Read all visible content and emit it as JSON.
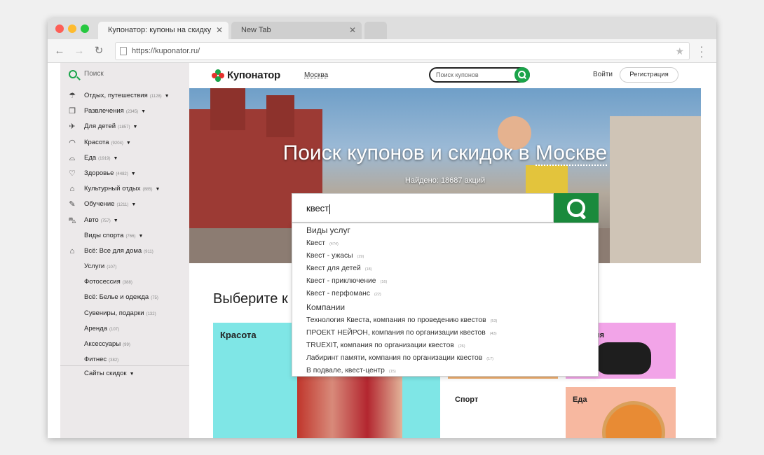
{
  "browser": {
    "tabs": [
      {
        "label": "Купонатор: купоны на скидку"
      },
      {
        "label": "New Tab"
      }
    ],
    "close_glyph": "✕",
    "url": "https://kuponator.ru/",
    "icons": [
      "back-icon",
      "forward-icon",
      "reload-icon",
      "page-icon",
      "star-icon",
      "menu-icon"
    ]
  },
  "sidebar": {
    "search_label": "Поиск",
    "items": [
      {
        "label": "Отдых, путешествия",
        "count": "(1128)",
        "arrow": true,
        "icon": "umbrella-icon",
        "glyph": "☂"
      },
      {
        "label": "Развлечения",
        "count": "(2345)",
        "arrow": true,
        "icon": "cube-icon",
        "glyph": "❒"
      },
      {
        "label": "Для детей",
        "count": "(1857)",
        "arrow": true,
        "icon": "airplane-icon",
        "glyph": "✈"
      },
      {
        "label": "Красота",
        "count": "(9204)",
        "arrow": true,
        "icon": "lips-icon",
        "glyph": "◠"
      },
      {
        "label": "Еда",
        "count": "(1919)",
        "arrow": true,
        "icon": "dish-icon",
        "glyph": "⌓"
      },
      {
        "label": "Здоровье",
        "count": "(4482)",
        "arrow": true,
        "icon": "heart-icon",
        "glyph": "♡"
      },
      {
        "label": "Культурный отдых",
        "count": "(885)",
        "arrow": true,
        "icon": "museum-icon",
        "glyph": "⌂"
      },
      {
        "label": "Обучение",
        "count": "(1211)",
        "arrow": true,
        "icon": "feather-icon",
        "glyph": "✎"
      },
      {
        "label": "Авто",
        "count": "(757)",
        "arrow": true,
        "icon": "car-icon",
        "glyph": "⛍"
      },
      {
        "label": "Виды спорта",
        "count": "(766)",
        "arrow": true,
        "icon": "",
        "glyph": ""
      },
      {
        "label": "Всё: Все для дома",
        "count": "(911)",
        "arrow": false,
        "icon": "house-icon",
        "glyph": "⌂"
      },
      {
        "label": "Услуги",
        "count": "(107)",
        "arrow": false,
        "icon": "",
        "glyph": ""
      },
      {
        "label": "Фотосессия",
        "count": "(388)",
        "arrow": false,
        "icon": "",
        "glyph": ""
      },
      {
        "label": "Всё: Белье и одежда",
        "count": "(75)",
        "arrow": false,
        "icon": "",
        "glyph": ""
      },
      {
        "label": "Сувениры, подарки",
        "count": "(132)",
        "arrow": false,
        "icon": "",
        "glyph": ""
      },
      {
        "label": "Аренда",
        "count": "(107)",
        "arrow": false,
        "icon": "",
        "glyph": ""
      },
      {
        "label": "Аксессуары",
        "count": "(99)",
        "arrow": false,
        "icon": "",
        "glyph": ""
      },
      {
        "label": "Фитнес",
        "count": "(382)",
        "arrow": false,
        "icon": "",
        "glyph": ""
      }
    ],
    "footer_label": "Сайты скидок"
  },
  "header": {
    "logo_text": "Купонатор",
    "city": "Москва",
    "search_placeholder": "Поиск купонов",
    "login": "Войти",
    "register": "Регистрация"
  },
  "hero": {
    "title_prefix": "Поиск купонов и скидок в ",
    "title_city": "Москве",
    "found_text": "Найдено: 18687 акций"
  },
  "search": {
    "value": "квест",
    "groups": [
      {
        "title": "Виды услуг",
        "items": [
          {
            "label": "Квест",
            "count": "(474)"
          },
          {
            "label": "Квест - ужасы",
            "count": "(29)"
          },
          {
            "label": "Квест для детей",
            "count": "(18)"
          },
          {
            "label": "Квест - приключение",
            "count": "(16)"
          },
          {
            "label": "Квест - перфоманс",
            "count": "(22)"
          }
        ]
      },
      {
        "title": "Компании",
        "items": [
          {
            "label": "Технология Квеста, компания по проведению квестов",
            "count": "(53)"
          },
          {
            "label": "ПРОЕКТ НЕЙРОН, компания по организации квестов",
            "count": "(43)"
          },
          {
            "label": "TRUEXIT, компания по организации квестов",
            "count": "(26)"
          },
          {
            "label": "Лабиринт памяти, компания по организации квестов",
            "count": "(17)"
          },
          {
            "label": "В подвале, квест-центр",
            "count": "(15)"
          }
        ]
      }
    ]
  },
  "section": {
    "title": "Выберите к",
    "cards": [
      {
        "label": "Красота",
        "color": "#7fe6e6"
      },
      {
        "label": "",
        "color": "#ffffff"
      },
      {
        "label": "лечения",
        "color": "#f2a4e8"
      },
      {
        "label": "Спорт",
        "color": "#ffffff"
      },
      {
        "label": "Еда",
        "color": "#f7b8a0"
      }
    ]
  },
  "colors": {
    "brand_green": "#1aa44a",
    "search_button": "#1a8a3c",
    "sidebar_bg": "#ece9ea"
  }
}
